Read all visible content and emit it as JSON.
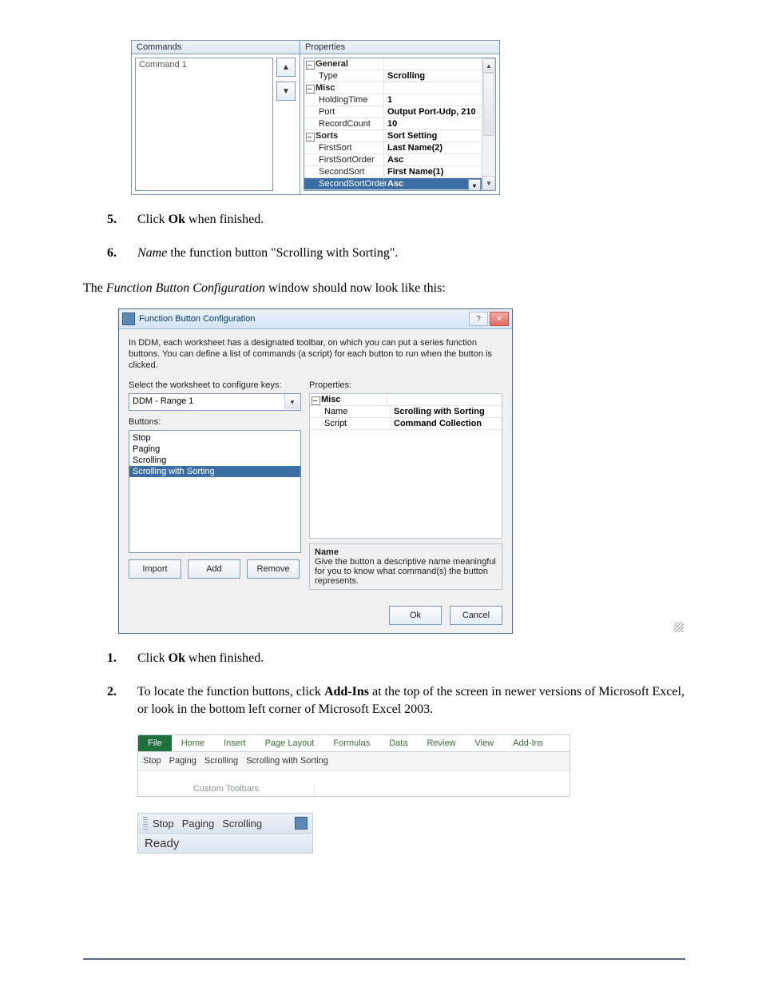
{
  "fig1": {
    "left_header": "Commands",
    "right_header": "Properties",
    "list_item": "Command 1",
    "rows": [
      {
        "type": "cat",
        "key": "General"
      },
      {
        "type": "row",
        "key": "Type",
        "val": "Scrolling"
      },
      {
        "type": "cat",
        "key": "Misc"
      },
      {
        "type": "row",
        "key": "HoldingTime",
        "val": "1"
      },
      {
        "type": "row",
        "key": "Port",
        "val": "Output Port-Udp, 210"
      },
      {
        "type": "row",
        "key": "RecordCount",
        "val": "10"
      },
      {
        "type": "cat",
        "key": "Sorts",
        "val": "Sort Setting"
      },
      {
        "type": "row",
        "key": "FirstSort",
        "val": "Last Name(2)"
      },
      {
        "type": "row",
        "key": "FirstSortOrder",
        "val": "Asc"
      },
      {
        "type": "row",
        "key": "SecondSort",
        "val": "First Name(1)"
      },
      {
        "type": "sel",
        "key": "SecondSortOrder",
        "val": "Asc"
      }
    ]
  },
  "step5": {
    "num": "5.",
    "pre": "Click ",
    "bold": "Ok",
    "post": " when finished."
  },
  "step6": {
    "num": "6.",
    "italic": "Name",
    "mid": " the function button \"Scrolling with Sorting\"."
  },
  "note_pre": "The ",
  "note_italic": "Function Button Configuration",
  "note_post": " window should now look like this:",
  "fig2": {
    "title": "Function Button Configuration",
    "intro": "In DDM, each worksheet has a designated toolbar, on which you can put a series function buttons. You can define a list of commands (a script) for each button to run when the button is clicked.",
    "left_label": "Select the worksheet to configure keys:",
    "combo": "DDM - Range 1",
    "buttons_label": "Buttons:",
    "list": [
      "Stop",
      "Paging",
      "Scrolling",
      "Scrolling with Sorting"
    ],
    "btn_import": "Import",
    "btn_add": "Add",
    "btn_remove": "Remove",
    "right_label": "Properties:",
    "props": [
      {
        "type": "cat",
        "key": "Misc"
      },
      {
        "type": "row",
        "key": "Name",
        "val": "Scrolling with Sorting"
      },
      {
        "type": "row",
        "key": "Script",
        "val": "Command Collection"
      }
    ],
    "desc_title": "Name",
    "desc_body": "Give the button a descriptive name meaningful for you to know what command(s) the button represents.",
    "ok": "Ok",
    "cancel": "Cancel"
  },
  "step1": {
    "num": "1.",
    "pre": "Click ",
    "bold": "Ok",
    "post": " when finished."
  },
  "step2": {
    "num": "2.",
    "pre": "To locate the function buttons, click ",
    "bold": "Add-Ins",
    "post": " at the top of the screen in newer versions of Microsoft Excel, or look in the bottom left corner of Microsoft Excel 2003."
  },
  "fig3": {
    "tabs": [
      "File",
      "Home",
      "Insert",
      "Page Layout",
      "Formulas",
      "Data",
      "Review",
      "View",
      "Add-Ins"
    ],
    "strip": [
      "Stop",
      "Paging",
      "Scrolling",
      "Scrolling with Sorting"
    ],
    "group": "Custom Toolbars"
  },
  "fig4": {
    "items": [
      "Stop",
      "Paging",
      "Scrolling"
    ],
    "status": "Ready"
  }
}
